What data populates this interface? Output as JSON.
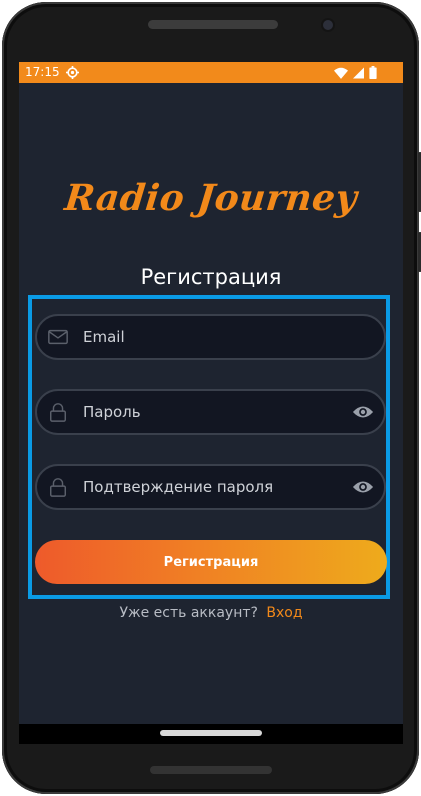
{
  "status_bar": {
    "time": "17:15",
    "color": "#f28a1b",
    "icons": [
      "settings-icon",
      "wifi-icon",
      "signal-icon",
      "battery-icon"
    ]
  },
  "app": {
    "logo_text": "Radio Journey",
    "screen_title": "Регистрация"
  },
  "form": {
    "email": {
      "placeholder": "Email",
      "icon": "mail-icon"
    },
    "password": {
      "placeholder": "Пароль",
      "icon": "lock-icon",
      "toggle_icon": "eye-icon"
    },
    "confirm_password": {
      "placeholder": "Подтверждение пароля",
      "icon": "lock-icon",
      "toggle_icon": "eye-icon"
    },
    "submit_label": "Регистрация"
  },
  "footer": {
    "prompt": "Уже есть аккаунт?",
    "login_link": "Вход"
  },
  "colors": {
    "accent": "#f2891a",
    "background": "#1e2430",
    "field_background": "#121622",
    "highlight_border": "#0a9be6",
    "button_gradient_start": "#ee5a2b",
    "button_gradient_end": "#eeab1c"
  }
}
